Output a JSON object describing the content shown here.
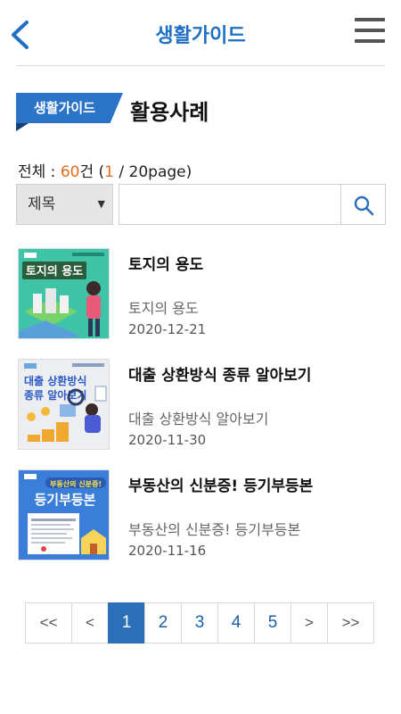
{
  "header": {
    "title": "생활가이드",
    "back_icon": "chevron-left-icon",
    "menu_icon": "hamburger-menu-icon"
  },
  "section": {
    "badge": "생활가이드",
    "title": "활용사례"
  },
  "count": {
    "prefix": "전체 : ",
    "total": "60",
    "unit": "건 (",
    "current": "1",
    "suffix": " / 20page)"
  },
  "search": {
    "select_label": "제목",
    "input_value": "",
    "input_placeholder": "",
    "button_icon": "search-icon"
  },
  "items": [
    {
      "title": "토지의 용도",
      "subtitle": "토지의 용도",
      "date": "2020-12-21",
      "thumb_text": "토지의 용도"
    },
    {
      "title": "대출 상환방식 종류 알아보기",
      "subtitle": "대출 상환방식 알아보기",
      "date": "2020-11-30",
      "thumb_text_1": "대출 상환방식",
      "thumb_text_2": "종류 알아보기"
    },
    {
      "title": "부동산의 신분증! 등기부등본",
      "subtitle": "부동산의 신분증! 등기부등본",
      "date": "2020-11-16",
      "thumb_text_1": "부동산의 신분증!",
      "thumb_text_2": "등기부등본"
    }
  ],
  "pagination": {
    "first": "<<",
    "prev": "<",
    "pages": [
      "1",
      "2",
      "3",
      "4",
      "5"
    ],
    "active": "1",
    "next": ">",
    "last": ">>"
  },
  "colors": {
    "accent": "#1f6fc4",
    "badge": "#2a73c7",
    "count_highlight": "#e36b1b",
    "active_page": "#2a6fb8"
  }
}
